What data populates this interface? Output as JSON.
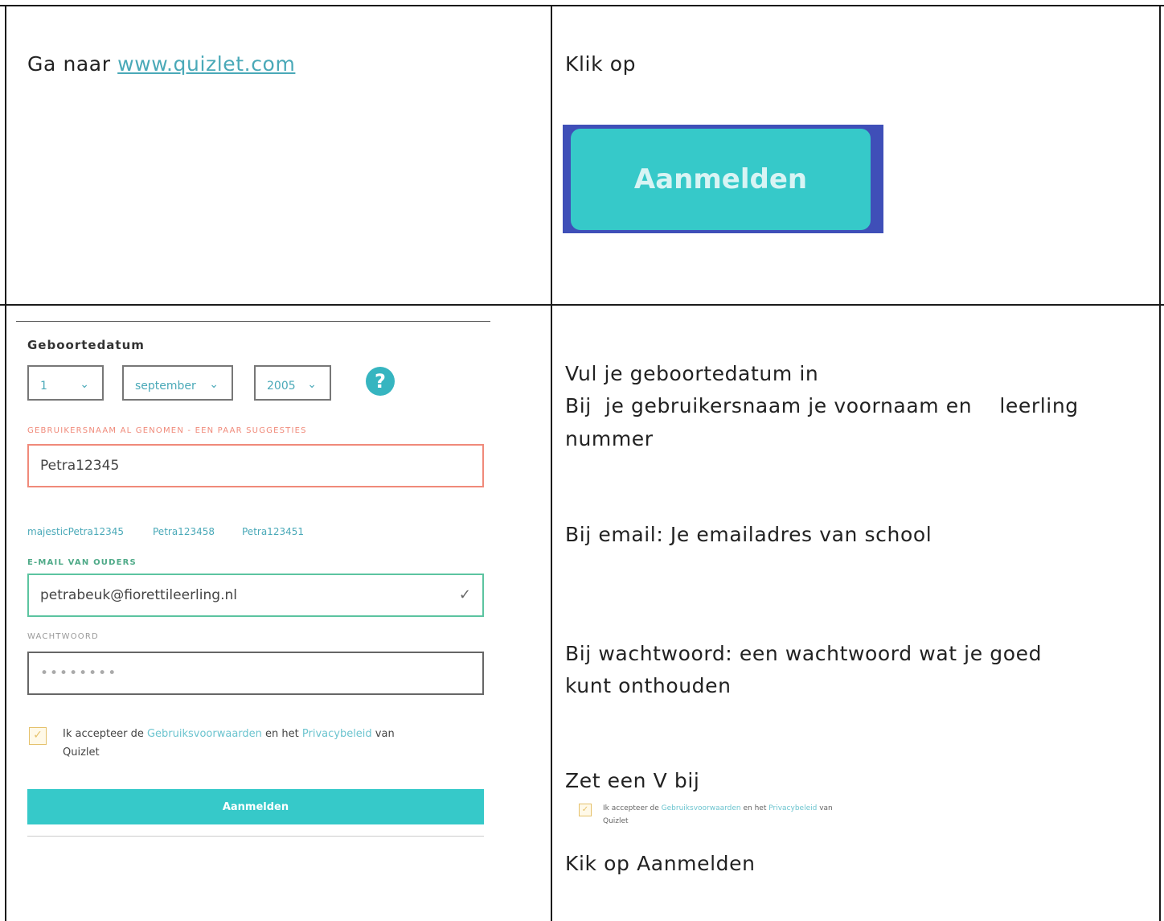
{
  "row1": {
    "left_prefix": "Ga naar ",
    "left_link": "www.quizlet.com",
    "right_text": "Klik op",
    "button_label": "Aanmelden"
  },
  "form": {
    "birthdate_label": "Geboortedatum",
    "day": "1",
    "month": "september",
    "year": "2005",
    "help_symbol": "?",
    "username_error": "GEBRUIKERSNAAM AL GENOMEN - EEN PAAR SUGGESTIES",
    "username_value": "Petra12345",
    "suggestions": [
      "majesticPetra12345",
      "Petra123458",
      "Petra123451"
    ],
    "email_label": "E-MAIL VAN OUDERS",
    "email_value": "petrabeuk@fiorettileerling.nl",
    "password_label": "WACHTWOORD",
    "password_value": "••••••••",
    "terms_prefix": "Ik accepteer de ",
    "terms_link1": "Gebruiksvoorwaarden",
    "terms_mid": " en het ",
    "terms_link2": "Privacybeleid",
    "terms_suffix": " van",
    "terms_line2": "Quizlet",
    "submit_label": "Aanmelden",
    "colors": {
      "teal": "#36c9c9",
      "error": "#f08a7a",
      "valid": "#5cc4a0",
      "checkbox": "#e5c16b"
    },
    "icons": [
      "chevron-down-icon",
      "help-icon",
      "checkmark-icon",
      "checkbox-icon"
    ]
  },
  "instructions": {
    "line1": "Vul je geboortedatum in",
    "line2": "Bij  je gebruikersnaam je voornaam en    leerling",
    "line3": "nummer",
    "line4": "Bij email: Je emailadres van school",
    "line5": "Bij wachtwoord: een wachtwoord wat je goed",
    "line6": "kunt onthouden",
    "line7": "Zet een V bij",
    "line8": "Kik op Aanmelden"
  }
}
